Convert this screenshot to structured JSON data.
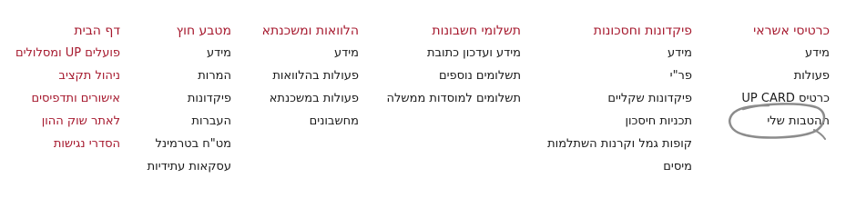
{
  "menu": {
    "columns": [
      {
        "key": "credit-cards",
        "heading": "כרטיסי אשראי",
        "items": [
          "מידע",
          "פעולות",
          "כרטיס UP CARD",
          "ההטבות שלי"
        ]
      },
      {
        "key": "deposits-savings",
        "heading": "פיקדונות וחסכונות",
        "items": [
          "מידע",
          "פר\"י",
          "פיקדונות שקליים",
          "תכניות חיסכון",
          "קופות גמל וקרנות השתלמות",
          "מיסים"
        ]
      },
      {
        "key": "account-payments",
        "heading": "תשלומי חשבונות",
        "items": [
          "מידע ועדכון כתובת",
          "תשלומים נוספים",
          "תשלומים למוסדות ממשלה"
        ]
      },
      {
        "key": "loans-mortgage",
        "heading": "הלוואות ומשכנתא",
        "items": [
          "מידע",
          "פעולות בהלוואות",
          "פעולות במשכנתא",
          "מחשבונים"
        ]
      },
      {
        "key": "foreign-currency",
        "heading": "מטבע חוץ",
        "items": [
          "מידע",
          "המרות",
          "פיקדונות",
          "העברות",
          "מט\"ח בטרמינל",
          "עסקאות עתידיות"
        ]
      }
    ],
    "quick_links": [
      "דף הבית",
      "פועלים UP ומסלולים",
      "ניהול תקציב",
      "אישורים ותדפיסים",
      "לאתר שוק ההון",
      "הסדרי נגישות"
    ],
    "colors": {
      "heading": "#a6192e",
      "item": "#1a1a1a",
      "scribble": "#8c8c8c"
    }
  }
}
